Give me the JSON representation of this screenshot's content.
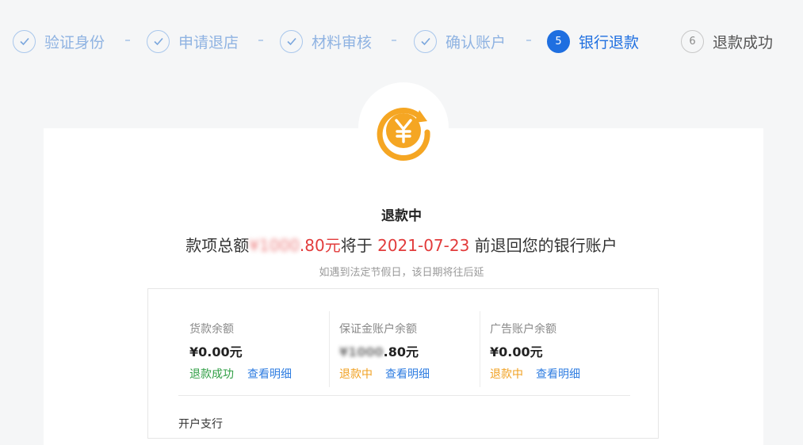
{
  "steps": [
    {
      "label": "验证身份",
      "state": "done"
    },
    {
      "label": "申请退店",
      "state": "done"
    },
    {
      "label": "材料审核",
      "state": "done"
    },
    {
      "label": "确认账户",
      "state": "done"
    },
    {
      "label": "银行退款",
      "state": "active",
      "number": "5"
    },
    {
      "label": "退款成功",
      "state": "pending",
      "number": "6"
    }
  ],
  "status": {
    "title": "退款中",
    "refund_prefix": "款项总额",
    "amount_masked": "¥1000",
    "amount_visible": ".80元",
    "mid": "将于 ",
    "date": "2021-07-23",
    "suffix": " 前退回您的银行账户",
    "note": "如遇到法定节假日，该日期将往后延"
  },
  "balances": [
    {
      "label": "货款余额",
      "amount": "¥0.00元",
      "status": "退款成功",
      "status_color": "#2f9e44",
      "link": "查看明细"
    },
    {
      "label": "保证金账户余额",
      "amount_masked": "¥1000",
      "amount": ".80元",
      "status": "退款中",
      "status_color": "#f0a020",
      "link": "查看明细"
    },
    {
      "label": "广告账户余额",
      "amount": "¥0.00元",
      "status": "退款中",
      "status_color": "#f0a020",
      "link": "查看明细"
    }
  ],
  "bank": {
    "label": "开户支行"
  },
  "colors": {
    "accent": "#1f6fe0",
    "done": "#8fb3e2",
    "refund_red": "#e23b3b",
    "icon_orange": "#f5a623"
  },
  "icons": {
    "done_step": "check-icon",
    "refund": "yen-refund-icon"
  }
}
